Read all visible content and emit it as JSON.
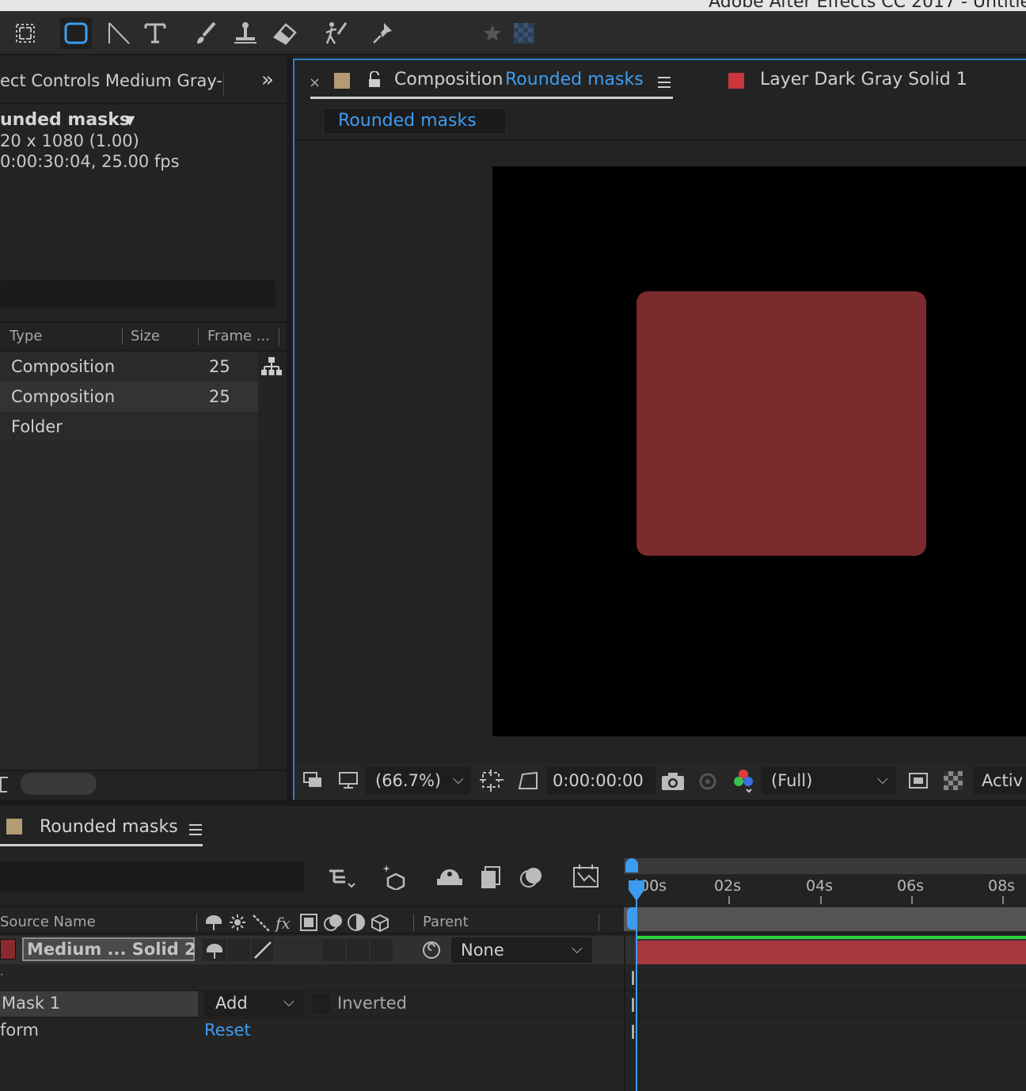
{
  "window": {
    "title": "Adobe After Effects CC 2017 - Untitle"
  },
  "toolbar": {
    "tools": [
      "selection-box-icon",
      "rounded-rectangle-icon",
      "pen-icon",
      "type-icon",
      "brush-icon",
      "clone-stamp-icon",
      "eraser-icon",
      "roto-brush-icon",
      "puppet-pin-icon",
      "star-icon",
      "transparency-grid-icon"
    ]
  },
  "left_panel": {
    "tab_title": "ect Controls Medium Gray-",
    "comp_name": "unded masks",
    "comp_dims": "20 x 1080 (1.00)",
    "comp_duration": "0:00:30:04, 25.00 fps",
    "columns": {
      "type": "Type",
      "size": "Size",
      "frame": "Frame ..."
    },
    "rows": [
      {
        "type": "Composition",
        "frame": "25"
      },
      {
        "type": "Composition",
        "frame": "25"
      },
      {
        "type": "Folder",
        "frame": ""
      }
    ]
  },
  "viewer": {
    "close_label": "×",
    "tab_prefix": "Composition",
    "tab_comp": "Rounded masks",
    "layer_tab": "Layer Dark Gray Solid 1",
    "breadcrumb": "Rounded masks",
    "zoom": "(66.7%)",
    "timecode": "0:00:00:00",
    "resolution": "(Full)",
    "camera": "Activ",
    "shape_color": "#7b2a2d",
    "accent_color": "#3e9cf0"
  },
  "timeline": {
    "tab_title": "Rounded masks",
    "ruler_labels": [
      "00s",
      "02s",
      "04s",
      "06s",
      "08s"
    ],
    "columns": {
      "source": "Source Name",
      "parent": "Parent"
    },
    "layer": {
      "name": "Medium ... Solid 2",
      "parent": "None"
    },
    "mask": {
      "name": "Mask 1",
      "mode": "Add",
      "inverted": "Inverted"
    },
    "transform": {
      "name": "form",
      "reset": "Reset"
    }
  }
}
